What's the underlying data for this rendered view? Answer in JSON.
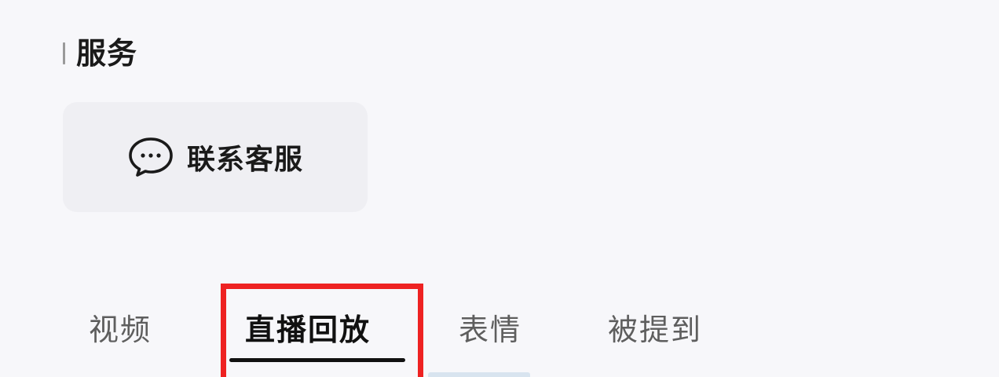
{
  "section": {
    "title": "服务"
  },
  "service_card": {
    "label": "联系客服",
    "icon": "chat-bubble-icon"
  },
  "tabs": [
    {
      "label": "视频",
      "active": false
    },
    {
      "label": "直播回放",
      "active": true
    },
    {
      "label": "表情",
      "active": false
    },
    {
      "label": "被提到",
      "active": false
    }
  ],
  "colors": {
    "background": "#f7f7fa",
    "card": "#efeff3",
    "text": "#1a1a1a",
    "inactive_tab": "#5e5e5e",
    "highlight": "#ee2222"
  }
}
